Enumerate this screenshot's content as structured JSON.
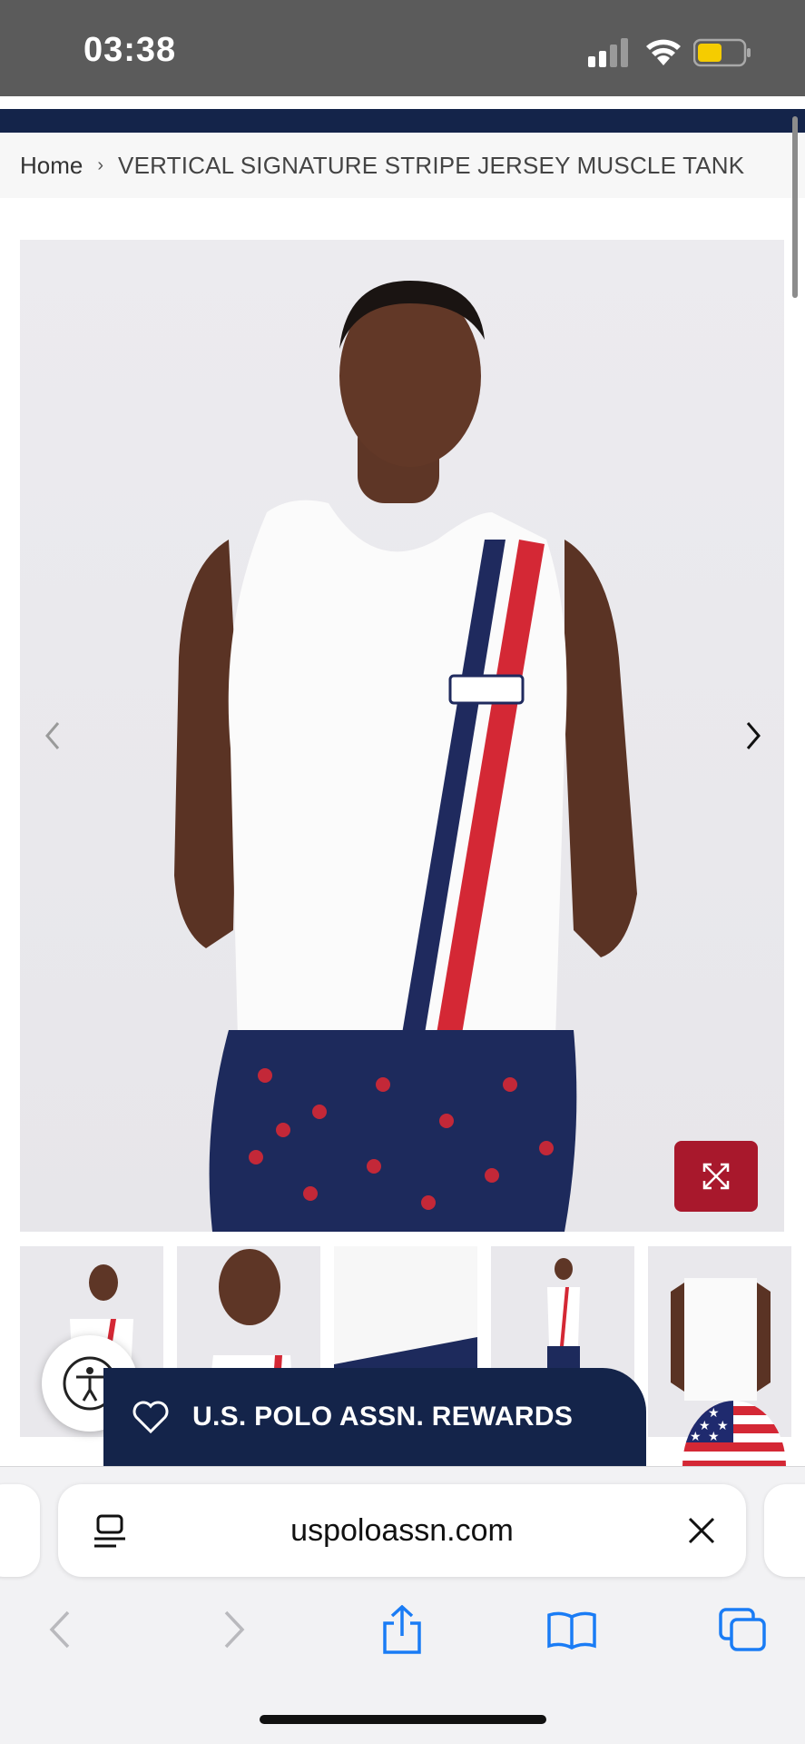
{
  "status_bar": {
    "time": "03:38"
  },
  "breadcrumb": {
    "home": "Home",
    "separator": "›",
    "current": "VERTICAL SIGNATURE STRIPE JERSEY MUSCLE TANK"
  },
  "product": {
    "image_icons": {
      "prev": "chevron-left-icon",
      "next": "chevron-right-icon",
      "expand": "expand-icon"
    },
    "thumbnail_count": 5
  },
  "rewards": {
    "label": "U.S. POLO ASSN. REWARDS"
  },
  "browser": {
    "url": "uspoloassn.com"
  },
  "colors": {
    "navy": "#14244a",
    "accent_red": "#a8182c",
    "ios_blue": "#1a7cf5"
  }
}
